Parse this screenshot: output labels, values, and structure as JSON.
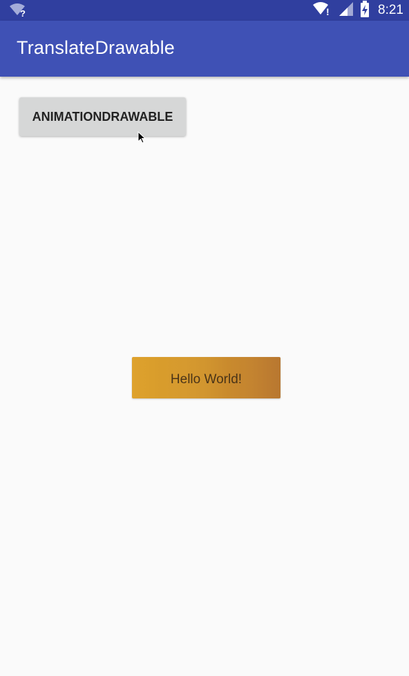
{
  "status_bar": {
    "time": "8:21",
    "icons": [
      "wifi-unknown-icon",
      "wifi-icon",
      "signal-icon",
      "battery-charging-icon"
    ],
    "wifi_unknown_mark": "?",
    "wifi_mark": "!",
    "background_color": "#303f9f"
  },
  "app_bar": {
    "title": "TranslateDrawable",
    "background_color": "#3f51b5"
  },
  "main": {
    "button_label": "ANIMATIONDRAWABLE",
    "hello_text": "Hello World!",
    "background_color": "#fafafa"
  }
}
